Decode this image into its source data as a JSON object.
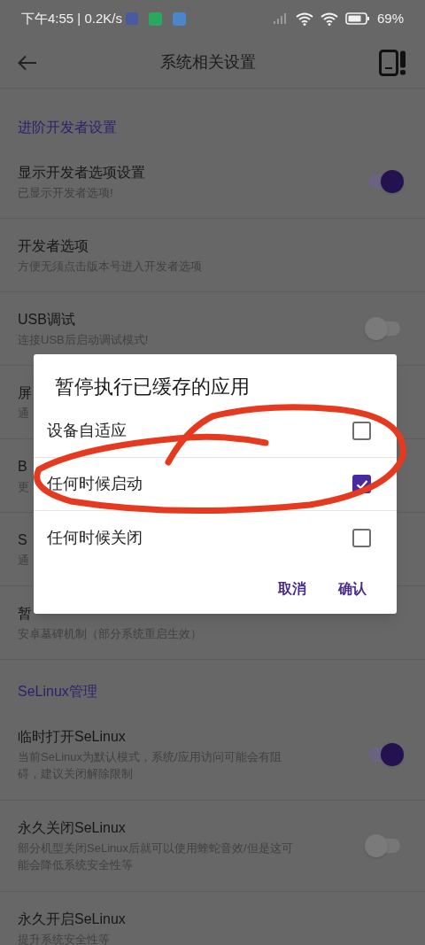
{
  "status_bar": {
    "time": "下午4:55 | 0.2K/s",
    "battery": "69%"
  },
  "app_bar": {
    "title": "系统相关设置"
  },
  "sections": [
    {
      "header": "进阶开发者设置",
      "rows": [
        {
          "kind": "toggle",
          "title": "显示开发者选项设置",
          "subtitle": "已显示开发者选项!",
          "on": true
        },
        {
          "kind": "plain",
          "title": "开发者选项",
          "subtitle": "方便无须点击版本号进入开发者选项"
        },
        {
          "kind": "toggle",
          "title": "USB调试",
          "subtitle": "连接USB后启动调试模式!",
          "on": false
        },
        {
          "kind": "plain",
          "title": "屏",
          "subtitle": "通"
        },
        {
          "kind": "plain",
          "title": "B",
          "subtitle": "更"
        },
        {
          "kind": "plain",
          "title": "S",
          "subtitle": "通"
        },
        {
          "kind": "plain",
          "title": "暂",
          "subtitle": "安卓墓碑机制（部分系统重启生效）"
        }
      ]
    },
    {
      "header": "SeLinux管理",
      "rows": [
        {
          "kind": "toggle",
          "title": "临时打开SeLinux",
          "subtitle": "当前SeLinux为默认模式，系统/应用访问可能会有阻碍，建议关闭解除限制",
          "on": true
        },
        {
          "kind": "toggle",
          "title": "永久关闭SeLinux",
          "subtitle": "部分机型关闭SeLinux后就可以使用蝰蛇音效/但是这可能会降低系统安全性等",
          "on": false
        },
        {
          "kind": "plain",
          "title": "永久开启SeLinux",
          "subtitle": "提升系统安全性等"
        }
      ]
    }
  ],
  "dialog": {
    "title": "暂停执行已缓存的应用",
    "options": [
      {
        "label": "设备自适应",
        "checked": false
      },
      {
        "label": "任何时候启动",
        "checked": true
      },
      {
        "label": "任何时候关闭",
        "checked": false
      }
    ],
    "buttons": [
      "取消",
      "确认"
    ]
  }
}
